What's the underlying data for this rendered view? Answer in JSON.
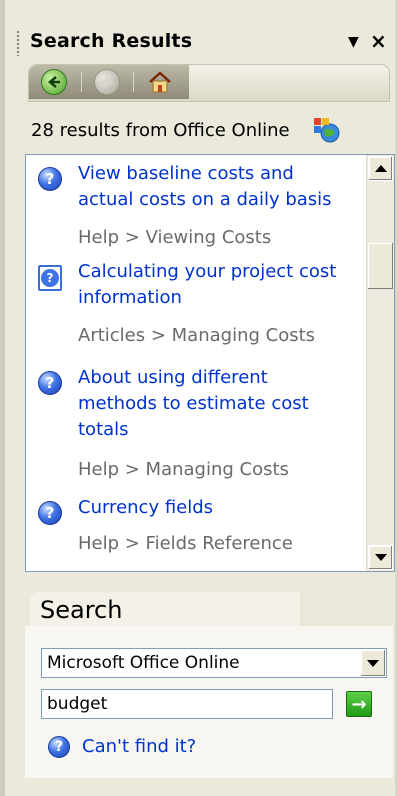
{
  "pane": {
    "title": "Search Results",
    "menu_glyph": "▼",
    "close_glyph": "×"
  },
  "nav": {
    "back_icon": "back-arrow-icon",
    "forward_icon": "forward-arrow-icon",
    "home_icon": "home-icon"
  },
  "results": {
    "summary": "28 results from Office Online",
    "items": [
      {
        "title_lines": [
          "View baseline costs and",
          "actual costs on a daily basis"
        ],
        "category": "Help > Viewing Costs",
        "icon": "help-icon"
      },
      {
        "title_lines": [
          "Calculating your project cost",
          "information"
        ],
        "category": "Articles > Managing Costs",
        "icon": "article-icon"
      },
      {
        "title_lines": [
          "About using different",
          "methods to estimate cost",
          "totals"
        ],
        "category": "Help > Managing Costs",
        "icon": "help-icon"
      },
      {
        "title_lines": [
          "Currency fields"
        ],
        "category": "Help > Fields Reference",
        "icon": "help-icon"
      }
    ]
  },
  "search": {
    "heading": "Search",
    "scope_value": "Microsoft Office Online",
    "query_value": "budget",
    "go_glyph": "→",
    "cant_find": "Can't find it?"
  },
  "colors": {
    "link": "#0033cc",
    "crumb": "#6a6a6a",
    "pane_bg": "#ebe9dc"
  }
}
